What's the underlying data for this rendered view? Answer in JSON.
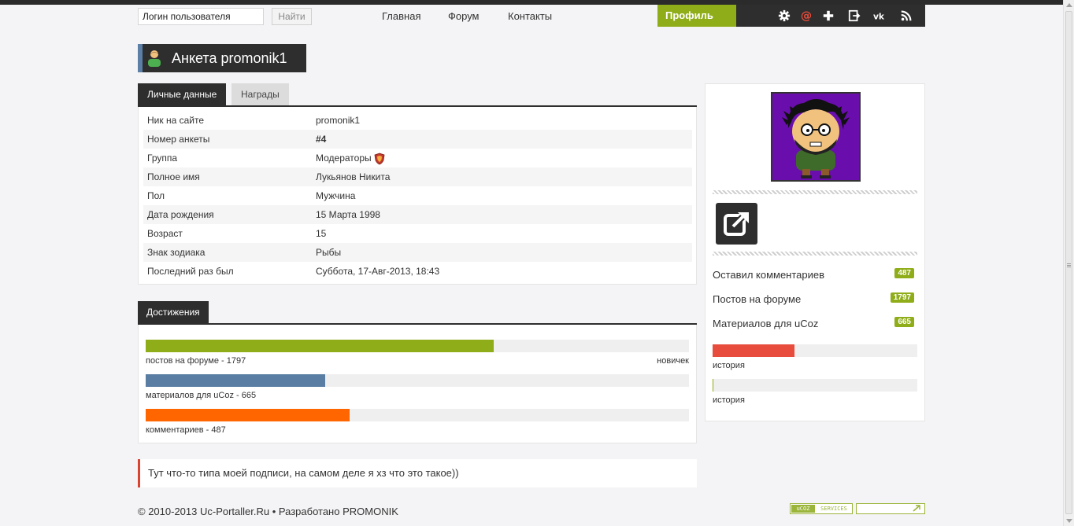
{
  "header": {
    "search": {
      "value": "Логин пользователя",
      "button": "Найти"
    },
    "nav": [
      "Главная",
      "Форум",
      "Контакты"
    ],
    "profile_label": "Профиль",
    "toolbar_icons": [
      "gear-icon",
      "at-icon",
      "plus-icon",
      "logout-icon",
      "vk-icon",
      "rss-icon"
    ]
  },
  "page_title": "Анкета promonik1",
  "tabs": [
    "Личные данные",
    "Награды"
  ],
  "profile_fields": [
    {
      "label": "Ник на сайте",
      "value": "promonik1"
    },
    {
      "label": "Номер анкеты",
      "value": "#4"
    },
    {
      "label": "Группа",
      "value": "Модераторы"
    },
    {
      "label": "Полное имя",
      "value": "Лукьянов Никита"
    },
    {
      "label": "Пол",
      "value": "Мужчина"
    },
    {
      "label": "Дата рождения",
      "value": "15 Марта 1998"
    },
    {
      "label": "Возраст",
      "value": "15"
    },
    {
      "label": "Знак зодиака",
      "value": "Рыбы"
    },
    {
      "label": "Последний раз был",
      "value": "Суббота, 17-Авг-2013, 18:43"
    }
  ],
  "achievements": {
    "title": "Достижения",
    "bars": [
      {
        "caption": "постов на форуме - 1797",
        "rank": "новичек",
        "fraction": 0.64,
        "color": "#8fad19"
      },
      {
        "caption": "материалов для uCoz - 665",
        "rank": "",
        "fraction": 0.33,
        "color": "#5a7da3"
      },
      {
        "caption": "комментариев - 487",
        "rank": "",
        "fraction": 0.375,
        "color": "#ff6600"
      }
    ]
  },
  "signature": "Тут что-то типа моей подписи, на самом деле я хз что это такое))",
  "sidebar": {
    "stats": [
      {
        "label": "Оставил комментариев",
        "count": "487"
      },
      {
        "label": "Постов на форуме",
        "count": "1797"
      },
      {
        "label": "Материалов для uCoz",
        "count": "665"
      }
    ],
    "bars": [
      {
        "caption": "история",
        "fraction": 0.4,
        "color": "#e74c3c"
      },
      {
        "caption": "история",
        "fraction": 0.005,
        "color": "#8fad19"
      }
    ]
  },
  "footer": {
    "copyright": "© 2010-2013 Uc-Portaller.Ru • Разработано PROMONIK",
    "badge_left": "uCOZ",
    "badge_right": "SERVICES"
  }
}
